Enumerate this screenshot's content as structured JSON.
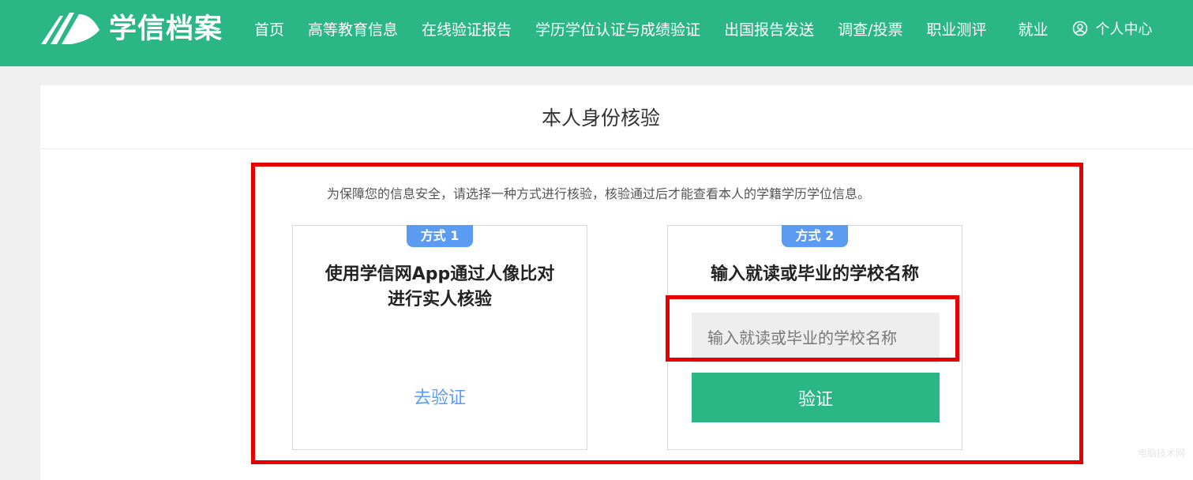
{
  "header": {
    "brand": "学信档案",
    "nav": [
      "首页",
      "高等教育信息",
      "在线验证报告",
      "学历学位认证与成绩验证",
      "出国报告发送",
      "调查/投票",
      "职业测评",
      "就业"
    ],
    "user_label": "个人中心",
    "icons": {
      "logo": "book-pages-logo",
      "user": "user-circle-icon"
    }
  },
  "page": {
    "title": "本人身份核验",
    "notice": "为保障您的信息安全，请选择一种方式进行核验，核验通过后才能查看本人的学籍学历学位信息。"
  },
  "option1": {
    "badge": "方式 1",
    "title_line1": "使用学信网App通过人像比对",
    "title_line2": "进行实人核验",
    "link": "去验证"
  },
  "option2": {
    "badge": "方式 2",
    "title": "输入就读或毕业的学校名称",
    "input_placeholder": "输入就读或毕业的学校名称",
    "input_value": "",
    "button": "验证"
  },
  "watermark": "电脑技术网",
  "colors": {
    "brand_green": "#2bb686",
    "badge_blue": "#5b9bf2",
    "highlight_red": "#e60000",
    "input_bg": "#eeeeee"
  }
}
